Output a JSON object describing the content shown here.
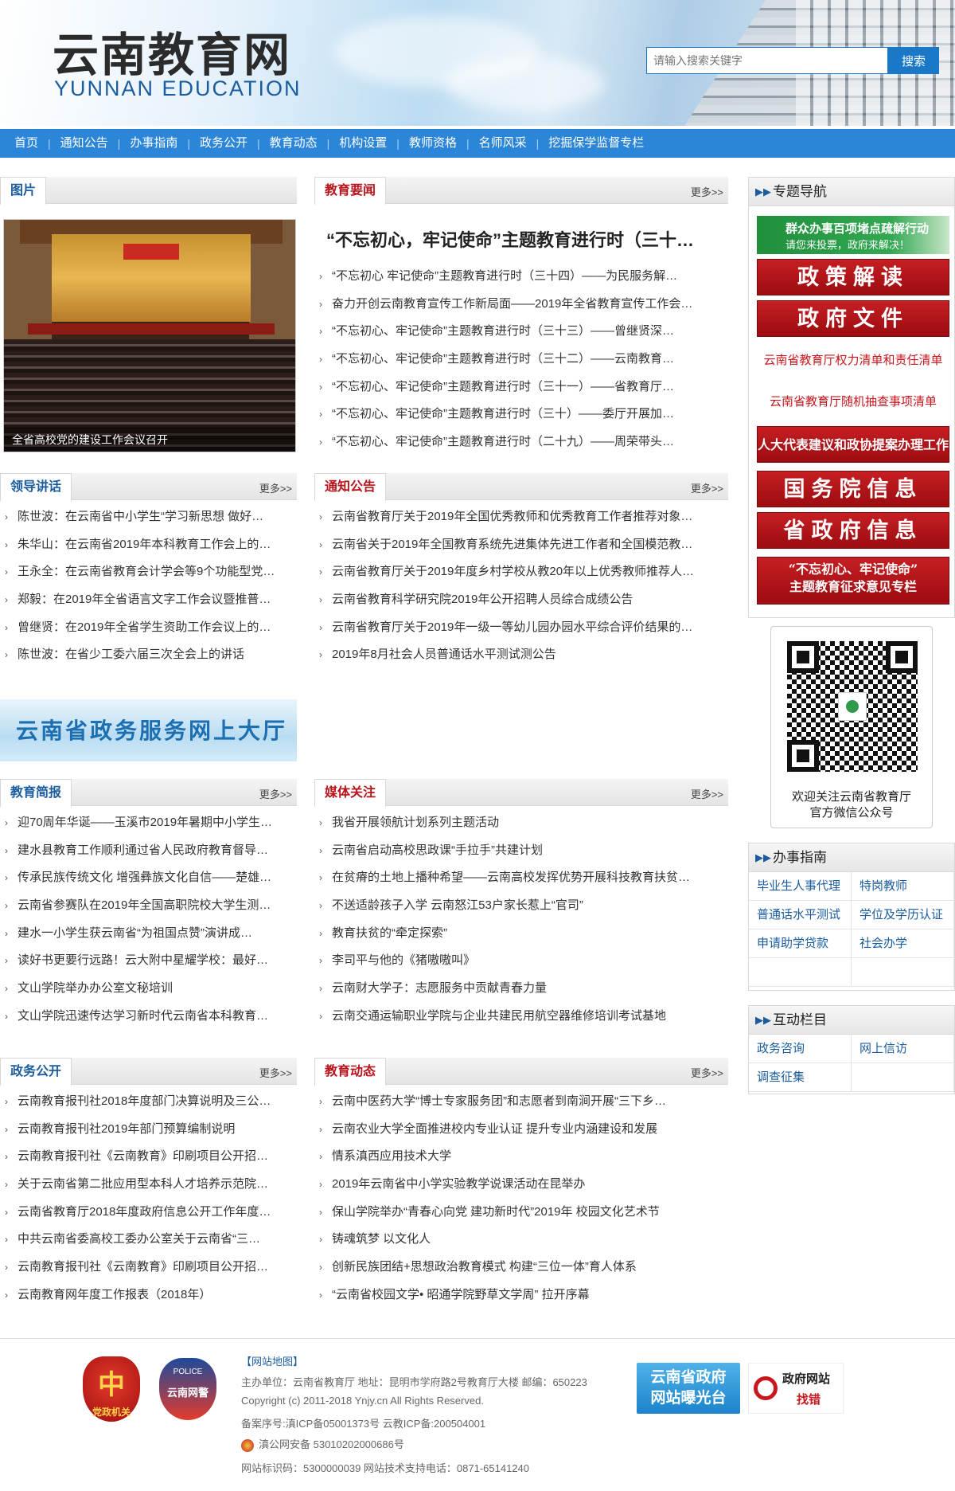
{
  "header": {
    "logo_cn": "云南教育网",
    "logo_en": "YUNNAN EDUCATION",
    "search_placeholder": "请输入搜索关键字",
    "search_button": "搜索"
  },
  "nav": [
    "首页",
    "通知公告",
    "办事指南",
    "政务公开",
    "教育动态",
    "机构设置",
    "教师资格",
    "名师风采",
    "挖掘保学监督专栏"
  ],
  "more_label": "更多>>",
  "photo": {
    "title": "图片",
    "caption": "全省高校党的建设工作会议召开"
  },
  "edu_news": {
    "title": "教育要闻",
    "headline": "“不忘初心，牢记使命”主题教育进行时（三十…",
    "items": [
      "“不忘初心 牢记使命”主题教育进行时（三十四）——为民服务解…",
      "奋力开创云南教育宣传工作新局面——2019年全省教育宣传工作会…",
      "“不忘初心、牢记使命”主题教育进行时（三十三）——曾继贤深…",
      "“不忘初心、牢记使命”主题教育进行时（三十二）——云南教育…",
      "“不忘初心、牢记使命”主题教育进行时（三十一）——省教育厅…",
      "“不忘初心、牢记使命”主题教育进行时（三十）——委厅开展加…",
      "“不忘初心、牢记使命”主题教育进行时（二十九）——周荣带头…"
    ]
  },
  "leader": {
    "title": "领导讲话",
    "items": [
      "陈世波：在云南省中小学生“学习新思想 做好…",
      "朱华山：在云南省2019年本科教育工作会上的…",
      "王永全：在云南省教育会计学会等9个功能型党…",
      "郑毅：在2019年全省语言文字工作会议暨推普…",
      "曾继贤：在2019年全省学生资助工作会议上的…",
      "陈世波：在省少工委六届三次全会上的讲话"
    ]
  },
  "notice": {
    "title": "通知公告",
    "items": [
      "云南省教育厅关于2019年全国优秀教师和优秀教育工作者推荐对象…",
      "云南省关于2019年全国教育系统先进集体先进工作者和全国模范教…",
      "云南省教育厅关于2019年度乡村学校从教20年以上优秀教师推荐人…",
      "云南省教育科学研究院2019年公开招聘人员综合成绩公告",
      "云南省教育厅关于2019年一级一等幼儿园办园水平综合评价结果的…",
      "2019年8月社会人员普通话水平测试测公告"
    ]
  },
  "gov_banner": "云南省政务服务网上大厅",
  "brief": {
    "title": "教育简报",
    "items": [
      "迎70周年华诞——玉溪市2019年暑期中小学生…",
      "建水县教育工作顺利通过省人民政府教育督导…",
      "传承民族传统文化 增强彝族文化自信——楚雄…",
      "云南省参赛队在2019年全国高职院校大学生测…",
      "建水一小学生获云南省“为祖国点赞”演讲成…",
      "读好书更要行远路！云大附中星耀学校：最好…",
      "文山学院举办办公室文秘培训",
      "文山学院迅速传达学习新时代云南省本科教育…"
    ]
  },
  "media": {
    "title": "媒体关注",
    "items": [
      "我省开展领航计划系列主题活动",
      "云南省启动高校思政课“手拉手”共建计划",
      "在贫瘠的土地上播种希望——云南高校发挥优势开展科技教育扶贫…",
      "不送适龄孩子入学 云南怒江53户家长惹上“官司”",
      "教育扶贫的“牵定探索”",
      "李司平与他的《猪嗷嗷叫》",
      "云南财大学子：志愿服务中贡献青春力量",
      "云南交通运输职业学院与企业共建民用航空器维修培训考试基地"
    ]
  },
  "gov_open": {
    "title": "政务公开",
    "items": [
      "云南教育报刊社2018年度部门决算说明及三公…",
      "云南教育报刊社2019年部门预算编制说明",
      "云南教育报刊社《云南教育》印刷项目公开招…",
      "关于云南省第二批应用型本科人才培养示范院…",
      "云南省教育厅2018年度政府信息公开工作年度…",
      "中共云南省委高校工委办公室关于云南省“三…",
      "云南教育报刊社《云南教育》印刷项目公开招…",
      "云南教育网年度工作报表（2018年）"
    ]
  },
  "edu_dyn": {
    "title": "教育动态",
    "items": [
      "云南中医药大学“博士专家服务团”和志愿者到南涧开展“三下乡…",
      "云南农业大学全面推进校内专业认证 提升专业内涵建设和发展",
      "情系滇西应用技术大学",
      "2019年云南省中小学实验教学说课活动在昆举办",
      "保山学院举办“青春心向党 建功新时代”2019年 校园文化艺术节",
      "铸魂筑梦 以文化人",
      "创新民族团结+思想政治教育模式 构建“三位一体”育人体系",
      "“云南省校园文学• 昭通学院野草文学周” 拉开序幕"
    ]
  },
  "topic_nav": {
    "title": "专题导航",
    "banner_main": "群众办事百项堵点疏解行动",
    "banner_sub": "请您来投票，政府来解决！",
    "btn_policy": "政策解读",
    "btn_gov_doc": "政府文件",
    "link1": "云南省教育厅权力清单和责任清单",
    "link2": "云南省教育厅随机抽查事项清单",
    "btn_npc": "人大代表建议和政协提案办理工作",
    "btn_state": "国务院信息",
    "btn_prov": "省政府信息",
    "btn_opinion_1": "“不忘初心、牢记使命”",
    "btn_opinion_2": "主题教育征求意见专栏"
  },
  "qr": {
    "caption_1": "欢迎关注云南省教育厅",
    "caption_2": "官方微信公众号"
  },
  "guide": {
    "title": "办事指南",
    "items": [
      "毕业生人事代理",
      "特岗教师",
      "普通话水平测试",
      "学位及学历认证",
      "申请助学贷款",
      "社会办学",
      "",
      ""
    ]
  },
  "interact": {
    "title": "互动栏目",
    "items": [
      "政务咨询",
      "网上信访",
      "调查征集",
      ""
    ]
  },
  "footer": {
    "seal1_char": "中",
    "seal1_text": "党政机关",
    "seal2_top": "POLICE",
    "seal2_text": "云南网警",
    "sitemap": "【网站地图】",
    "line1": "主办单位：云南省教育厅 地址：昆明市学府路2号教育厅大楼 邮编：650223",
    "line2": "Copyright (c) 2011-2018 Ynjy.cn All Rights Reserved.",
    "line3": "备案序号:滇ICP备05001373号 云教ICP备:200504001",
    "line4": "滇公网安备 53010202000686号",
    "line5": "网站标识码：5300000039 网站技术支持电话：0871-65141240",
    "badge1_line1": "云南省政府",
    "badge1_line2": "网站曝光台",
    "badge2_line1": "政府网站",
    "badge2_line2": "找错"
  }
}
